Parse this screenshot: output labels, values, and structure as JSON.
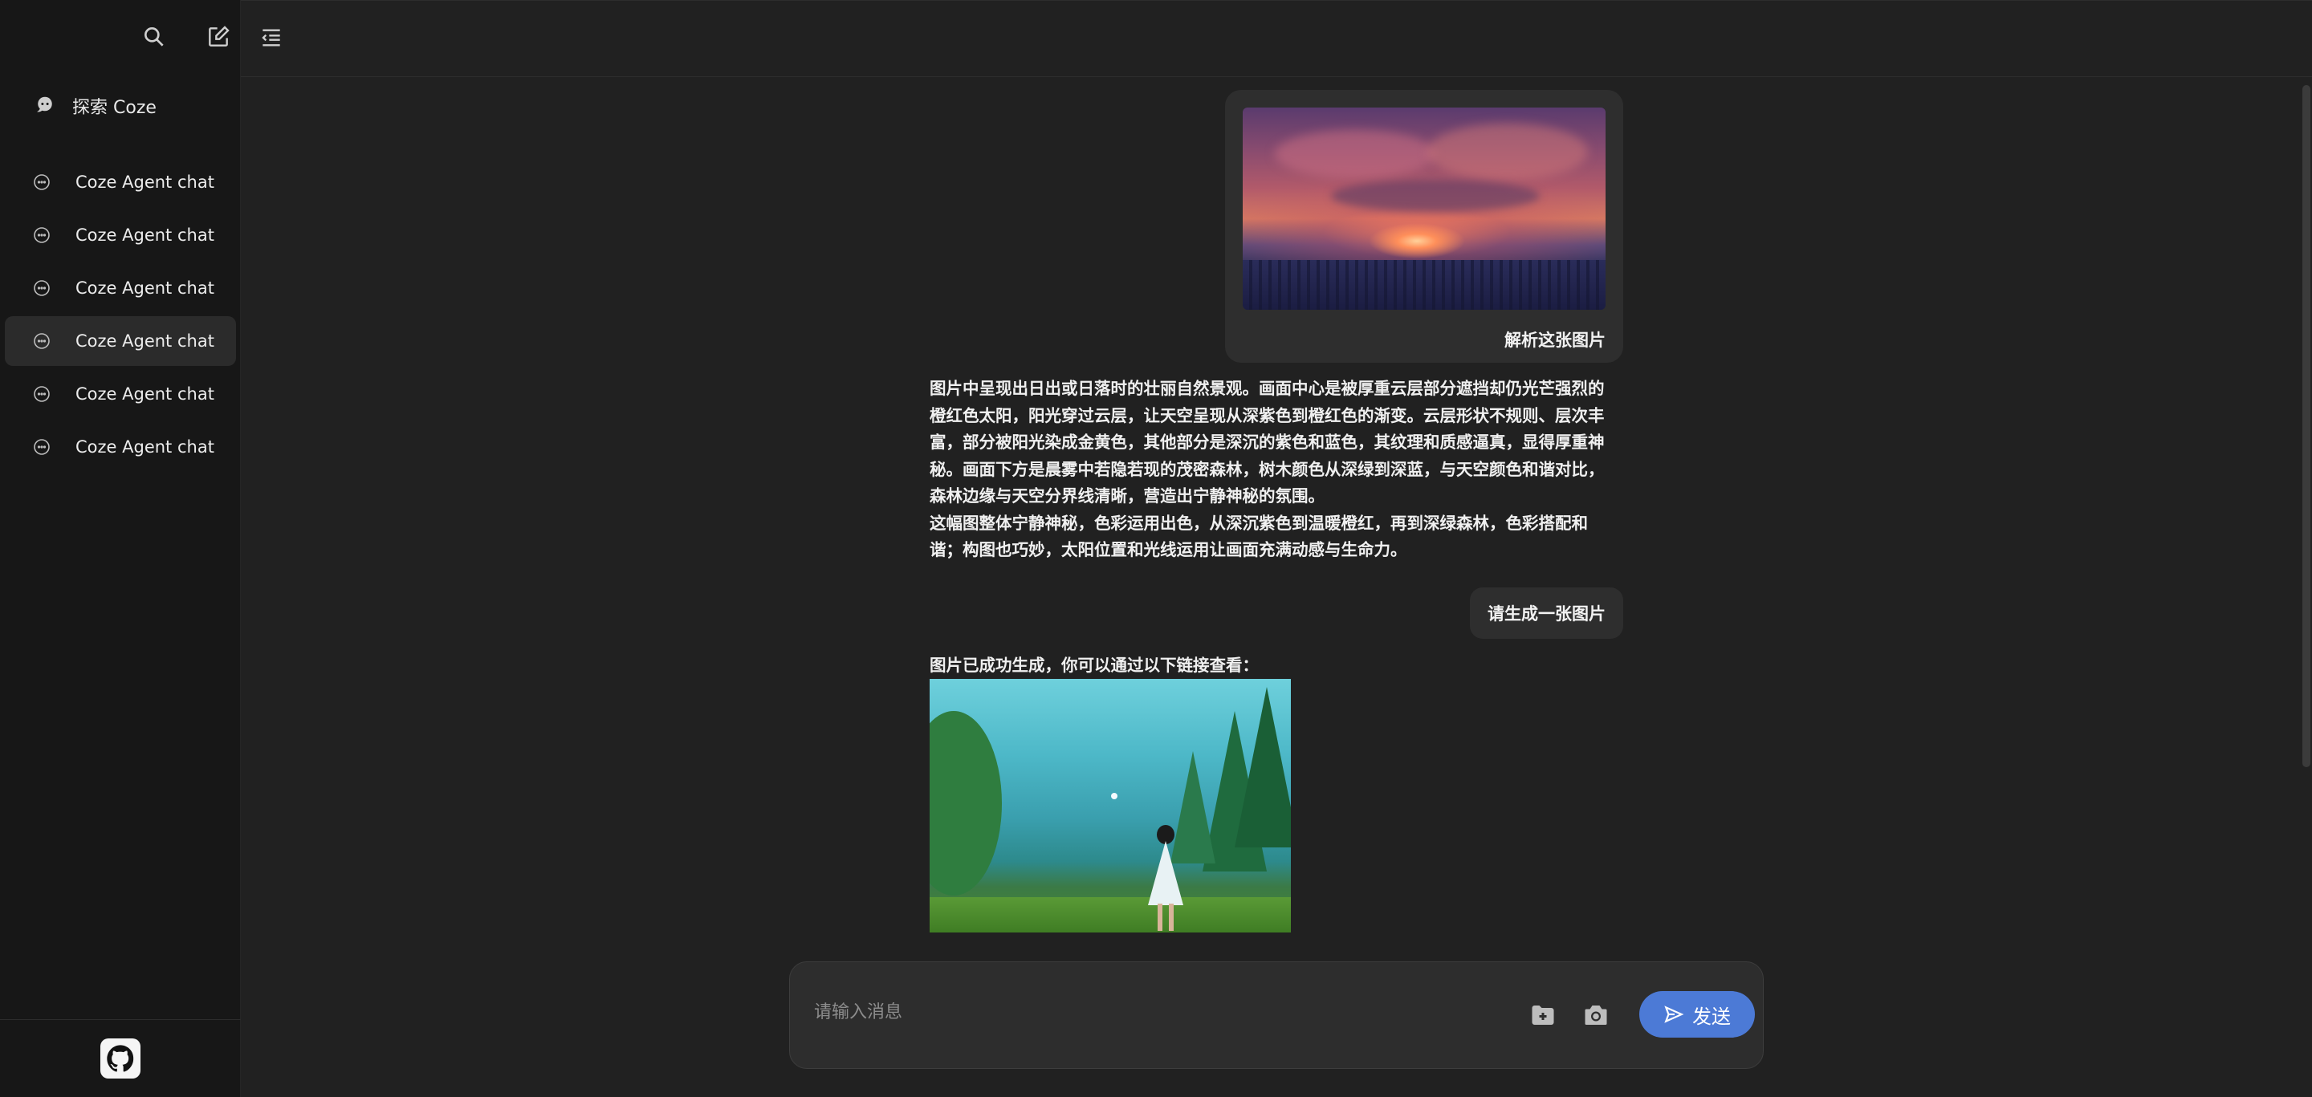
{
  "sidebar": {
    "explore_label": "探索 Coze",
    "chats": [
      {
        "label": "Coze Agent chat"
      },
      {
        "label": "Coze Agent chat"
      },
      {
        "label": "Coze Agent chat"
      },
      {
        "label": "Coze Agent chat",
        "active": true
      },
      {
        "label": "Coze Agent chat"
      },
      {
        "label": "Coze Agent chat"
      }
    ],
    "icons": [
      "search-icon",
      "new-chat-icon",
      "collapse-sidebar-icon",
      "explore-icon",
      "chat-bubble-icon",
      "github-icon"
    ]
  },
  "conversation": {
    "user_image_caption": "解析这张图片",
    "bot_analysis_p1": "图片中呈现出日出或日落时的壮丽自然景观。画面中心是被厚重云层部分遮挡却仍光芒强烈的橙红色太阳，阳光穿过云层，让天空呈现从深紫色到橙红色的渐变。云层形状不规则、层次丰富，部分被阳光染成金黄色，其他部分是深沉的紫色和蓝色，其纹理和质感逼真，显得厚重神秘。画面下方是晨雾中若隐若现的茂密森林，树木颜色从深绿到深蓝，与天空颜色和谐对比，森林边缘与天空分界线清晰，营造出宁静神秘的氛围。",
    "bot_analysis_p2": "这幅图整体宁静神秘，色彩运用出色，从深沉紫色到温暖橙红，再到深绿森林，色彩搭配和谐；构图也巧妙，太阳位置和光线运用让画面充满动感与生命力。",
    "user_message": "请生成一张图片",
    "bot_reply": "图片已成功生成，你可以通过以下链接查看："
  },
  "composer": {
    "placeholder": "请输入消息",
    "send_label": "发送",
    "icons": [
      "folder-add-icon",
      "camera-icon",
      "send-icon"
    ]
  },
  "colors": {
    "background": "#212121",
    "sidebar": "#171717",
    "bubble": "#2e2e2e",
    "accent": "#4c7ad6"
  }
}
